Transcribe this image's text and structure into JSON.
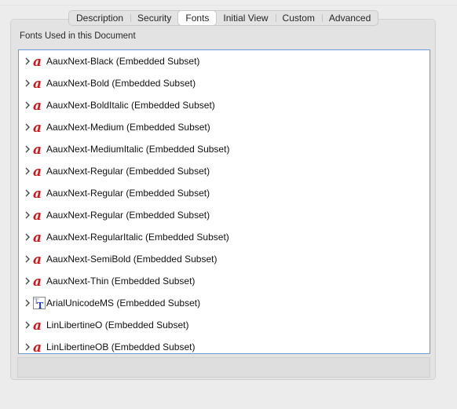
{
  "tabs": [
    {
      "label": "Description",
      "active": false
    },
    {
      "label": "Security",
      "active": false
    },
    {
      "label": "Fonts",
      "active": true
    },
    {
      "label": "Initial View",
      "active": false
    },
    {
      "label": "Custom",
      "active": false
    },
    {
      "label": "Advanced",
      "active": false
    }
  ],
  "fonts_group": {
    "label": "Fonts Used in this Document",
    "items": [
      {
        "name": "AauxNext-Black (Embedded Subset)",
        "icon": "acrobat-font-icon"
      },
      {
        "name": "AauxNext-Bold (Embedded Subset)",
        "icon": "acrobat-font-icon"
      },
      {
        "name": "AauxNext-BoldItalic (Embedded Subset)",
        "icon": "acrobat-font-icon"
      },
      {
        "name": "AauxNext-Medium (Embedded Subset)",
        "icon": "acrobat-font-icon"
      },
      {
        "name": "AauxNext-MediumItalic (Embedded Subset)",
        "icon": "acrobat-font-icon"
      },
      {
        "name": "AauxNext-Regular (Embedded Subset)",
        "icon": "acrobat-font-icon"
      },
      {
        "name": "AauxNext-Regular (Embedded Subset)",
        "icon": "acrobat-font-icon"
      },
      {
        "name": "AauxNext-Regular (Embedded Subset)",
        "icon": "acrobat-font-icon"
      },
      {
        "name": "AauxNext-RegularItalic (Embedded Subset)",
        "icon": "acrobat-font-icon"
      },
      {
        "name": "AauxNext-SemiBold (Embedded Subset)",
        "icon": "acrobat-font-icon"
      },
      {
        "name": "AauxNext-Thin (Embedded Subset)",
        "icon": "acrobat-font-icon"
      },
      {
        "name": "ArialUnicodeMS (Embedded Subset)",
        "icon": "truetype-font-icon"
      },
      {
        "name": "LinLibertineO (Embedded Subset)",
        "icon": "acrobat-font-icon"
      },
      {
        "name": "LinLibertineOB (Embedded Subset)",
        "icon": "acrobat-font-icon"
      }
    ]
  },
  "colors": {
    "acrobat_red": "#d4141b",
    "truetype_blue": "#1d3fbf",
    "list_border": "#6a9bd8"
  }
}
